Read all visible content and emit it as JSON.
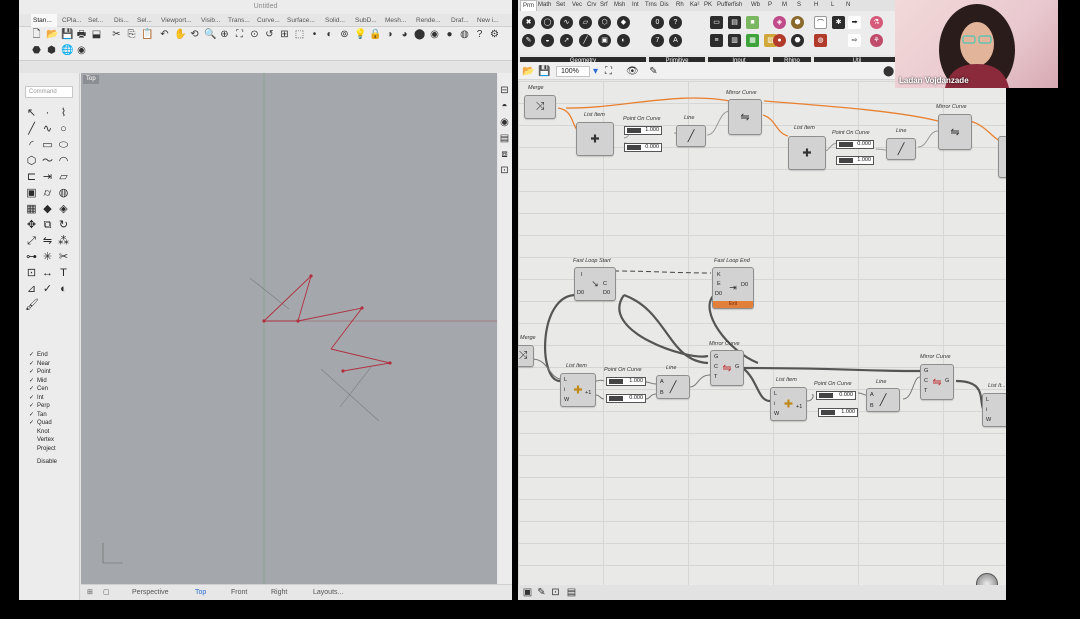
{
  "rhino": {
    "title": "Untitled",
    "tabs": [
      "Stan...",
      "CPla...",
      "Set...",
      "Dis...",
      "Sel...",
      "Viewport...",
      "Visib...",
      "Trans...",
      "Curve...",
      "Surface...",
      "Solid...",
      "SubD...",
      "Mesh...",
      "Rende...",
      "Draf...",
      "New i..."
    ],
    "command_placeholder": "Command",
    "viewport_label": "Top",
    "osnaps": [
      {
        "label": "End",
        "checked": true
      },
      {
        "label": "Near",
        "checked": true
      },
      {
        "label": "Point",
        "checked": true
      },
      {
        "label": "Mid",
        "checked": true
      },
      {
        "label": "Cen",
        "checked": true
      },
      {
        "label": "Int",
        "checked": true
      },
      {
        "label": "Perp",
        "checked": true
      },
      {
        "label": "Tan",
        "checked": true
      },
      {
        "label": "Quad",
        "checked": true
      },
      {
        "label": "Knot",
        "checked": false
      },
      {
        "label": "Vertex",
        "checked": false
      },
      {
        "label": "Project",
        "checked": false
      },
      {
        "label": "Disable",
        "checked": false
      }
    ],
    "viewport_tabs": [
      "Perspective",
      "Top",
      "Front",
      "Right",
      "Layouts..."
    ],
    "active_viewport_tab": "Top"
  },
  "gh": {
    "tabs": [
      "Prm",
      "Math",
      "Set",
      "Vec",
      "Crv",
      "Srf",
      "Msh",
      "Int",
      "Trns",
      "Dis",
      "Rh",
      "Ka²",
      "PK",
      "Pufferfish",
      "Wb",
      "P",
      "M",
      "S",
      "H",
      "L",
      "N"
    ],
    "active_tab": "Prm",
    "ribbon_categories": [
      "Geometry",
      "Primitive",
      "Input",
      "Rhino",
      "Util"
    ],
    "zoom": "100%",
    "components": {
      "merge_top": "Merge",
      "list_item_1": "List Item",
      "point_on_curve_1": "Point On Curve",
      "line_1": "Line",
      "mirror_curve_1": "Mirror Curve",
      "list_item_2": "List Item",
      "point_on_curve_2": "Point On Curve",
      "line_2": "Line",
      "mirror_curve_2": "Mirror Curve",
      "fast_loop_start": "Fast Loop Start",
      "fast_loop_end": "Fast Loop End",
      "merge_mid": "Merge",
      "list_item_3": "List Item",
      "point_on_curve_3": "Point On Curve",
      "line_3": "Line",
      "mirror_curve_3": "Mirror Curve",
      "list_item_4": "List Item",
      "point_on_curve_4": "Point On Curve",
      "line_4": "Line",
      "mirror_curve_4": "Mirror Curve",
      "list_item_5": "List It..."
    },
    "sliders": {
      "s1": "1.000",
      "s2": "0.000",
      "s3": "0.000",
      "s4": "1.000",
      "s5": "1.000",
      "s6": "0.000",
      "s7": "0.000",
      "s8": "1.000"
    },
    "loop_end_label": "Exit"
  },
  "webcam": {
    "name": "Ladan Vojdanzade"
  }
}
